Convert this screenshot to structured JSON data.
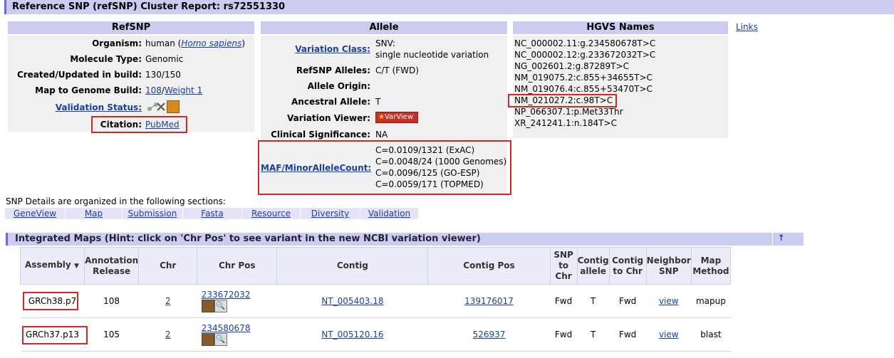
{
  "page_title": "Reference SNP (refSNP) Cluster Report: rs72551330",
  "refsnp": {
    "header": "RefSNP",
    "organism_label": "Organism:",
    "organism_prefix": "human (",
    "organism_link": "Homo sapiens",
    "organism_suffix": ")",
    "moltype_label": "Molecule Type:",
    "moltype_value": "Genomic",
    "created_label": "Created/Updated in build:",
    "created_value": "130/150",
    "map_label": "Map to Genome Build:",
    "map_link1": "108",
    "map_sep": "/",
    "map_link2": "Weight 1",
    "validation_label": "Validation Status:",
    "citation_label": "Citation:",
    "citation_link": "PubMed"
  },
  "allele": {
    "header": "Allele",
    "varclass_label": "Variation Class:",
    "varclass_value1": "SNV:",
    "varclass_value2": "single nucleotide variation",
    "alleles_label": "RefSNP Alleles:",
    "alleles_value": "C/T (FWD)",
    "origin_label": "Allele Origin:",
    "ancestral_label": "Ancestral Allele:",
    "ancestral_value": "T",
    "viewer_label": "Variation Viewer:",
    "viewer_button": "VarView",
    "clinical_label": "Clinical Significance:",
    "clinical_value": "NA",
    "maf_label": "MAF/MinorAlleleCount:",
    "maf_values": [
      "C=0.0109/1321 (ExAC)",
      "C=0.0048/24 (1000 Genomes)",
      "C=0.0096/125 (GO-ESP)",
      "C=0.0059/171 (TOPMED)"
    ]
  },
  "hgvs": {
    "header": "HGVS Names",
    "names": [
      "NC_000002.11:g.234580678T>C",
      "NC_000002.12:g.233672032T>C",
      "NG_002601.2:g.87289T>C",
      "NM_019075.2:c.855+34655T>C",
      "NM_019076.4:c.855+53470T>C",
      "NM_021027.2:c.98T>C",
      "NP_066307.1:p.Met33Thr",
      "XR_241241.1:n.184T>C"
    ]
  },
  "links_label": "Links",
  "sections_text": "SNP Details are organized in the following sections:",
  "tabs": [
    "GeneView",
    "Map",
    "Submission",
    "Fasta",
    "Resource",
    "Diversity",
    "Validation"
  ],
  "integrated_header": "Integrated Maps (Hint: click on 'Chr Pos' to see variant in the new NCBI variation viewer)",
  "table": {
    "columns": [
      "Assembly",
      "Annotation Release",
      "Chr",
      "Chr Pos",
      "Contig",
      "Contig Pos",
      "SNP to Chr",
      "Contig allele",
      "Contig to Chr",
      "Neighbor SNP",
      "Map Method"
    ],
    "rows": [
      {
        "assembly": "GRCh38.p7",
        "release": "108",
        "chr": "2",
        "chr_pos": "233672032",
        "contig": "NT_005403.18",
        "contig_pos": "139176017",
        "snp_to_chr": "Fwd",
        "contig_allele": "T",
        "contig_to_chr": "Fwd",
        "neighbor": "view",
        "method": "mapup"
      },
      {
        "assembly": "GRCh37.p13",
        "release": "105",
        "chr": "2",
        "chr_pos": "234580678",
        "contig": "NT_005120.16",
        "contig_pos": "526937",
        "snp_to_chr": "Fwd",
        "contig_allele": "T",
        "contig_to_chr": "Fwd",
        "neighbor": "view",
        "method": "blast"
      }
    ]
  },
  "colors": {
    "header_bg": "#ccccf2",
    "link": "#1a3fa3",
    "highlight": "#d42828",
    "panel": "#f0f0f0"
  }
}
